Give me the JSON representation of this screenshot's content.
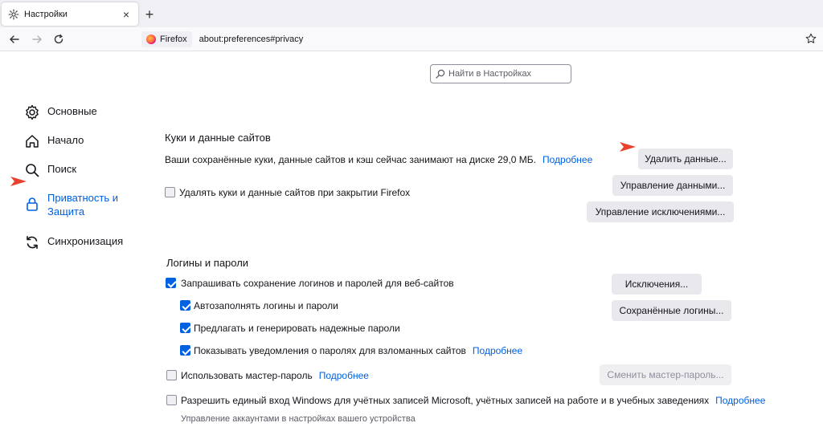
{
  "tab": {
    "title": "Настройки",
    "icon": "gear-icon"
  },
  "navbar": {
    "identity_label": "Firefox",
    "url": "about:preferences#privacy"
  },
  "search": {
    "placeholder": "Найти в Настройках"
  },
  "sidebar": {
    "items": [
      {
        "label": "Основные",
        "icon": "gear-icon"
      },
      {
        "label": "Начало",
        "icon": "home-icon"
      },
      {
        "label": "Поиск",
        "icon": "search-icon"
      },
      {
        "label": "Приватность и Защита",
        "icon": "lock-icon",
        "active": true
      },
      {
        "label": "Синхронизация",
        "icon": "sync-icon"
      }
    ]
  },
  "cookies": {
    "title": "Куки и данные сайтов",
    "usage_text": "Ваши сохранённые куки, данные сайтов и кэш сейчас занимают на диске 29,0 МБ.",
    "learn_more": "Подробнее",
    "delete_on_close": "Удалять куки и данные сайтов при закрытии Firefox",
    "delete_on_close_checked": false,
    "clear_button": "Удалить данные...",
    "manage_button": "Управление данными...",
    "exceptions_button": "Управление исключениями..."
  },
  "logins": {
    "title": "Логины и пароли",
    "ask_save": "Запрашивать сохранение логинов и паролей для веб-сайтов",
    "autofill": "Автозаполнять логины и пароли",
    "suggest": "Предлагать и генерировать надежные пароли",
    "breach_alerts": "Показывать уведомления о паролях для взломанных сайтов",
    "breach_learn_more": "Подробнее",
    "master_password": "Использовать мастер-пароль",
    "master_learn_more": "Подробнее",
    "windows_sso": "Разрешить единый вход Windows для учётных записей Microsoft, учётных записей на работе и в учебных заведениях",
    "windows_learn_more": "Подробнее",
    "windows_note": "Управление аккаунтами в настройках вашего устройства",
    "exceptions_button": "Исключения...",
    "saved_logins_button": "Сохранённые логины...",
    "change_master_button": "Сменить мастер-пароль..."
  },
  "colors": {
    "accent": "#0061e0",
    "annotation_arrow": "#e8412e"
  }
}
